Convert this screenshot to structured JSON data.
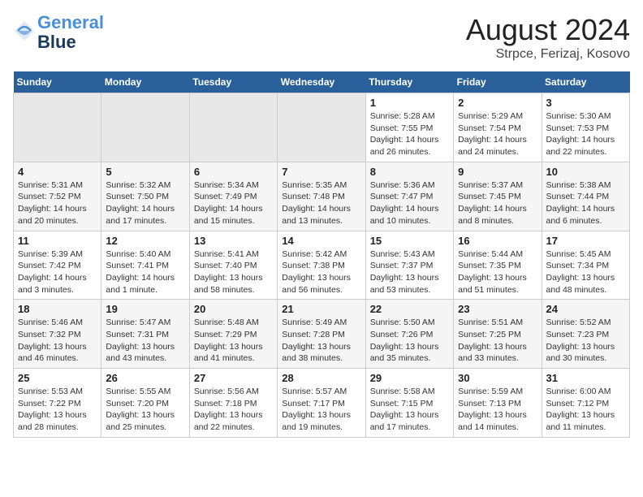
{
  "header": {
    "logo_line1": "General",
    "logo_line2": "Blue",
    "title": "August 2024",
    "subtitle": "Strpce, Ferizaj, Kosovo"
  },
  "weekdays": [
    "Sunday",
    "Monday",
    "Tuesday",
    "Wednesday",
    "Thursday",
    "Friday",
    "Saturday"
  ],
  "weeks": [
    [
      {
        "day": "",
        "empty": true
      },
      {
        "day": "",
        "empty": true
      },
      {
        "day": "",
        "empty": true
      },
      {
        "day": "",
        "empty": true
      },
      {
        "day": "1",
        "sunrise": "5:28 AM",
        "sunset": "7:55 PM",
        "daylight": "14 hours and 26 minutes."
      },
      {
        "day": "2",
        "sunrise": "5:29 AM",
        "sunset": "7:54 PM",
        "daylight": "14 hours and 24 minutes."
      },
      {
        "day": "3",
        "sunrise": "5:30 AM",
        "sunset": "7:53 PM",
        "daylight": "14 hours and 22 minutes."
      }
    ],
    [
      {
        "day": "4",
        "sunrise": "5:31 AM",
        "sunset": "7:52 PM",
        "daylight": "14 hours and 20 minutes."
      },
      {
        "day": "5",
        "sunrise": "5:32 AM",
        "sunset": "7:50 PM",
        "daylight": "14 hours and 17 minutes."
      },
      {
        "day": "6",
        "sunrise": "5:34 AM",
        "sunset": "7:49 PM",
        "daylight": "14 hours and 15 minutes."
      },
      {
        "day": "7",
        "sunrise": "5:35 AM",
        "sunset": "7:48 PM",
        "daylight": "14 hours and 13 minutes."
      },
      {
        "day": "8",
        "sunrise": "5:36 AM",
        "sunset": "7:47 PM",
        "daylight": "14 hours and 10 minutes."
      },
      {
        "day": "9",
        "sunrise": "5:37 AM",
        "sunset": "7:45 PM",
        "daylight": "14 hours and 8 minutes."
      },
      {
        "day": "10",
        "sunrise": "5:38 AM",
        "sunset": "7:44 PM",
        "daylight": "14 hours and 6 minutes."
      }
    ],
    [
      {
        "day": "11",
        "sunrise": "5:39 AM",
        "sunset": "7:42 PM",
        "daylight": "14 hours and 3 minutes."
      },
      {
        "day": "12",
        "sunrise": "5:40 AM",
        "sunset": "7:41 PM",
        "daylight": "14 hours and 1 minute."
      },
      {
        "day": "13",
        "sunrise": "5:41 AM",
        "sunset": "7:40 PM",
        "daylight": "13 hours and 58 minutes."
      },
      {
        "day": "14",
        "sunrise": "5:42 AM",
        "sunset": "7:38 PM",
        "daylight": "13 hours and 56 minutes."
      },
      {
        "day": "15",
        "sunrise": "5:43 AM",
        "sunset": "7:37 PM",
        "daylight": "13 hours and 53 minutes."
      },
      {
        "day": "16",
        "sunrise": "5:44 AM",
        "sunset": "7:35 PM",
        "daylight": "13 hours and 51 minutes."
      },
      {
        "day": "17",
        "sunrise": "5:45 AM",
        "sunset": "7:34 PM",
        "daylight": "13 hours and 48 minutes."
      }
    ],
    [
      {
        "day": "18",
        "sunrise": "5:46 AM",
        "sunset": "7:32 PM",
        "daylight": "13 hours and 46 minutes."
      },
      {
        "day": "19",
        "sunrise": "5:47 AM",
        "sunset": "7:31 PM",
        "daylight": "13 hours and 43 minutes."
      },
      {
        "day": "20",
        "sunrise": "5:48 AM",
        "sunset": "7:29 PM",
        "daylight": "13 hours and 41 minutes."
      },
      {
        "day": "21",
        "sunrise": "5:49 AM",
        "sunset": "7:28 PM",
        "daylight": "13 hours and 38 minutes."
      },
      {
        "day": "22",
        "sunrise": "5:50 AM",
        "sunset": "7:26 PM",
        "daylight": "13 hours and 35 minutes."
      },
      {
        "day": "23",
        "sunrise": "5:51 AM",
        "sunset": "7:25 PM",
        "daylight": "13 hours and 33 minutes."
      },
      {
        "day": "24",
        "sunrise": "5:52 AM",
        "sunset": "7:23 PM",
        "daylight": "13 hours and 30 minutes."
      }
    ],
    [
      {
        "day": "25",
        "sunrise": "5:53 AM",
        "sunset": "7:22 PM",
        "daylight": "13 hours and 28 minutes."
      },
      {
        "day": "26",
        "sunrise": "5:55 AM",
        "sunset": "7:20 PM",
        "daylight": "13 hours and 25 minutes."
      },
      {
        "day": "27",
        "sunrise": "5:56 AM",
        "sunset": "7:18 PM",
        "daylight": "13 hours and 22 minutes."
      },
      {
        "day": "28",
        "sunrise": "5:57 AM",
        "sunset": "7:17 PM",
        "daylight": "13 hours and 19 minutes."
      },
      {
        "day": "29",
        "sunrise": "5:58 AM",
        "sunset": "7:15 PM",
        "daylight": "13 hours and 17 minutes."
      },
      {
        "day": "30",
        "sunrise": "5:59 AM",
        "sunset": "7:13 PM",
        "daylight": "13 hours and 14 minutes."
      },
      {
        "day": "31",
        "sunrise": "6:00 AM",
        "sunset": "7:12 PM",
        "daylight": "13 hours and 11 minutes."
      }
    ]
  ],
  "labels": {
    "sunrise": "Sunrise:",
    "sunset": "Sunset:",
    "daylight": "Daylight:"
  }
}
